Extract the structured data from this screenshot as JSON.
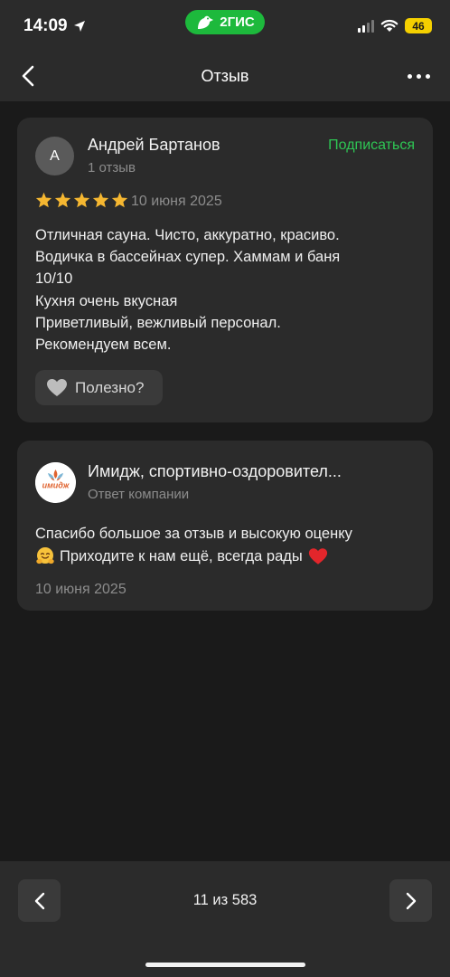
{
  "status_bar": {
    "time": "14:09",
    "brand": "2ГИС",
    "battery": "46",
    "icons": [
      "location-arrow-icon",
      "signal-icon",
      "wifi-icon",
      "battery-icon"
    ]
  },
  "nav": {
    "title": "Отзыв",
    "back_icon": "chevron-left-icon",
    "more_icon": "more-horizontal-icon"
  },
  "review": {
    "avatar_letter": "А",
    "author": "Андрей Бартанов",
    "author_reviews": "1 отзыв",
    "subscribe_label": "Подписаться",
    "rating": 5,
    "rating_max": 5,
    "date": "10 июня 2025",
    "text_lines": [
      "Отличная сауна. Чисто, аккуратно, красиво.",
      "Водичка в бассейнах супер. Хаммам и баня",
      "10/10",
      "Кухня очень вкусная",
      "Приветливый, вежливый персонал.",
      "Рекомендуем всем."
    ],
    "helpful_label": "Полезно?",
    "helpful_icon": "heart-icon"
  },
  "company_reply": {
    "logo_text": "имидж",
    "company_name": "Имидж, спортивно-оздоровител...",
    "subtitle": "Ответ компании",
    "text_line1": "Спасибо большое за отзыв и высокую оценку",
    "text_line2": "Приходите к нам ещё, всегда рады",
    "date": "10 июня 2025"
  },
  "pager": {
    "text": "11 из 583",
    "prev_icon": "chevron-left-icon",
    "next_icon": "chevron-right-icon"
  },
  "colors": {
    "accent_green": "#2ec654",
    "brand_green": "#1db93c",
    "star": "#f5b731",
    "card_bg": "#2b2b2b",
    "page_bg": "#1a1a1a"
  }
}
